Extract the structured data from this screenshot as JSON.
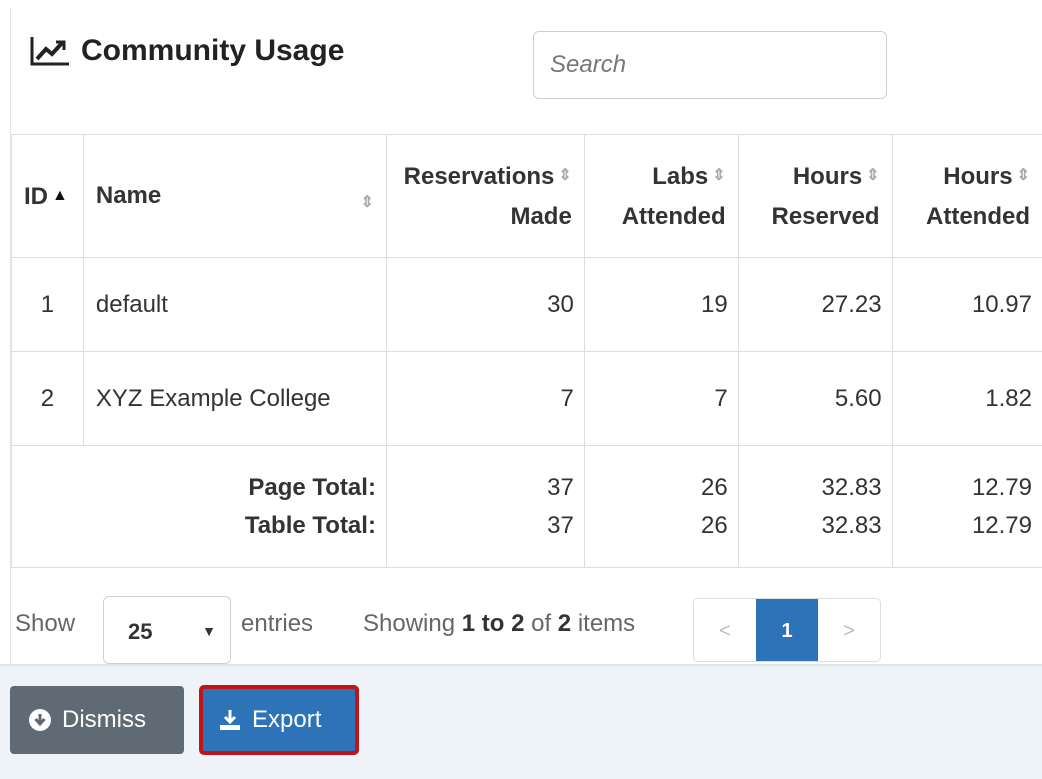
{
  "header": {
    "title": "Community Usage",
    "search_placeholder": "Search"
  },
  "table": {
    "columns": [
      {
        "line1": "ID",
        "line2": ""
      },
      {
        "line1": "Name",
        "line2": ""
      },
      {
        "line1": "Reservations",
        "line2": "Made"
      },
      {
        "line1": "Labs",
        "line2": "Attended"
      },
      {
        "line1": "Hours",
        "line2": "Reserved"
      },
      {
        "line1": "Hours",
        "line2": "Attended"
      }
    ],
    "rows": [
      {
        "id": "1",
        "name": "default",
        "reservations": "30",
        "labs": "19",
        "hours_reserved": "27.23",
        "hours_attended": "10.97"
      },
      {
        "id": "2",
        "name": "XYZ Example College",
        "reservations": "7",
        "labs": "7",
        "hours_reserved": "5.60",
        "hours_attended": "1.82"
      }
    ],
    "totals": {
      "page_label": "Page Total:",
      "table_label": "Table Total:",
      "page": {
        "reservations": "37",
        "labs": "26",
        "hours_reserved": "32.83",
        "hours_attended": "12.79"
      },
      "table": {
        "reservations": "37",
        "labs": "26",
        "hours_reserved": "32.83",
        "hours_attended": "12.79"
      }
    }
  },
  "footer": {
    "show_label": "Show",
    "page_size": "25",
    "entries_label": "entries",
    "showing_label": "Showing",
    "range": "1 to 2",
    "of_label": "of",
    "count": "2",
    "items_label": "items",
    "prev": "<",
    "current_page": "1",
    "next": ">"
  },
  "actions": {
    "dismiss_label": "Dismiss",
    "export_label": "Export"
  },
  "colors": {
    "primary": "#2d73b8",
    "secondary": "#5f6a74",
    "highlight": "#c0141b"
  }
}
